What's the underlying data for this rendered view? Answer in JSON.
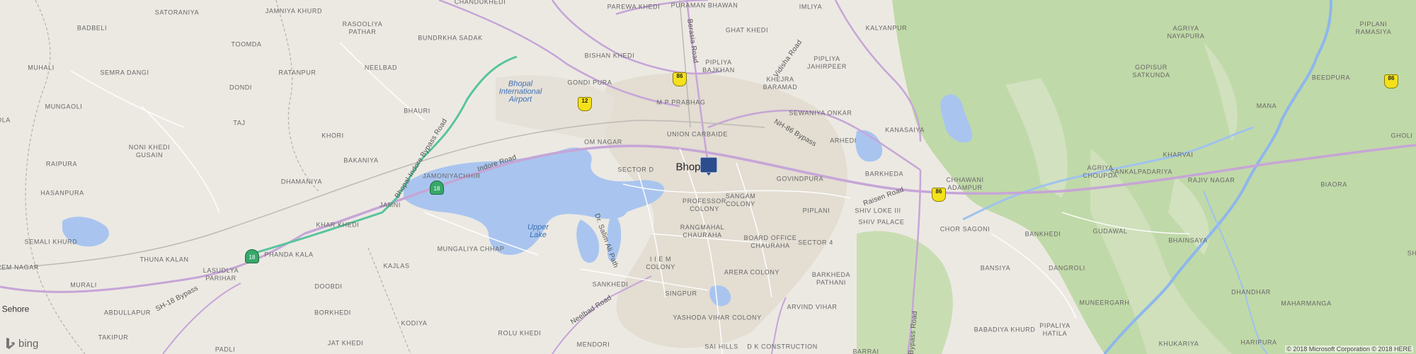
{
  "map": {
    "city_label": "Bhopal",
    "visible_city_label": "Bhop",
    "water": {
      "lake_upper": "Upper\nLake",
      "airport": "Bhopal\nInternational\nAirport"
    },
    "places": [
      {
        "id": "satoraniya",
        "text": "SATORANIYA"
      },
      {
        "id": "jamniya-khurd",
        "text": "JAMNIYA KHURD"
      },
      {
        "id": "chandukhedi",
        "text": "CHANDUKHEDI"
      },
      {
        "id": "parewa-khedi",
        "text": "PAREWA KHEDI"
      },
      {
        "id": "puraman-bhawan",
        "text": "PURAMAN BHAWAN"
      },
      {
        "id": "imliya",
        "text": "IMLIYA"
      },
      {
        "id": "badbeli",
        "text": "BADBELI"
      },
      {
        "id": "rasooliya-pathar",
        "text": "RASOOLIYA\nPATHAR"
      },
      {
        "id": "bundrkha-sadak",
        "text": "BUNDRKHA SADAK"
      },
      {
        "id": "ghat-khedi",
        "text": "GHAT KHEDI"
      },
      {
        "id": "kalyanpur",
        "text": "KALYANPUR"
      },
      {
        "id": "toomda",
        "text": "TOOMDA"
      },
      {
        "id": "bishan-khedi",
        "text": "BISHAN KHEDI"
      },
      {
        "id": "pipliya-bajkhan",
        "text": "PIPLIYA\nBAJKHAN"
      },
      {
        "id": "ratanpur",
        "text": "RATANPUR"
      },
      {
        "id": "neelbad",
        "text": "NEELBAD"
      },
      {
        "id": "pipliya-jahirpeer",
        "text": "PIPLIYA\nJAHIRPEER"
      },
      {
        "id": "muhali",
        "text": "MUHALI"
      },
      {
        "id": "semra-dangi",
        "text": "SEMRA DANGI"
      },
      {
        "id": "dondi",
        "text": "DONDI"
      },
      {
        "id": "gondi-pura",
        "text": "GONDI PURA"
      },
      {
        "id": "khejra-baramad",
        "text": "KHEJRA\nBARAMAD"
      },
      {
        "id": "m-p-prabhag",
        "text": "M P PRABHAG"
      },
      {
        "id": "sewaniya-onkar",
        "text": "SEWANIYA ONKAR"
      },
      {
        "id": "mungaoli",
        "text": "MUNGAOLI"
      },
      {
        "id": "bhauri",
        "text": "BHAURI"
      },
      {
        "id": "taj",
        "text": "TAJ"
      },
      {
        "id": "union-carbaide",
        "text": "UNION CARBAIDE"
      },
      {
        "id": "arhedi",
        "text": "ARHEDI"
      },
      {
        "id": "kanasaiya",
        "text": "KANASAIYA"
      },
      {
        "id": "khori",
        "text": "KHORI"
      },
      {
        "id": "om-nagar",
        "text": "OM NAGAR"
      },
      {
        "id": "noni-khedi-gusain",
        "text": "NONI KHEDI\nGUSAIN"
      },
      {
        "id": "raipura",
        "text": "RAIPURA"
      },
      {
        "id": "bakaniya",
        "text": "BAKANIYA"
      },
      {
        "id": "sector-d",
        "text": "SECTOR D"
      },
      {
        "id": "govindpura",
        "text": "GOVINDPURA"
      },
      {
        "id": "barkheda",
        "text": "BARKHEDA"
      },
      {
        "id": "chhawani-adampur",
        "text": "CHHAWANI\nADAMPUR"
      },
      {
        "id": "dhamaniya",
        "text": "DHAMANIYA"
      },
      {
        "id": "jamoniyachhir",
        "text": "JAMONIYACHHIR"
      },
      {
        "id": "hasanpura",
        "text": "HASANPURA"
      },
      {
        "id": "jamni",
        "text": "JAMNI"
      },
      {
        "id": "professor-colony",
        "text": "PROFESSOR\nCOLONY"
      },
      {
        "id": "sangam-colony",
        "text": "SANGAM\nCOLONY"
      },
      {
        "id": "piplani",
        "text": "PIPLANI"
      },
      {
        "id": "shiv-loke-iii",
        "text": "SHIV LOKE III"
      },
      {
        "id": "shiv-palace",
        "text": "SHIV PALACE"
      },
      {
        "id": "khar-khedi",
        "text": "KHAR KHEDI"
      },
      {
        "id": "semali-khurd",
        "text": "SEMALI KHURD"
      },
      {
        "id": "rangmahal-chauraha",
        "text": "RANGMAHAL\nCHAURAHA"
      },
      {
        "id": "board-office-chauraha",
        "text": "BOARD OFFICE\nCHAURAHA"
      },
      {
        "id": "sector-4",
        "text": "SECTOR 4"
      },
      {
        "id": "mungaliya-chhap",
        "text": "MUNGALIYA CHHAP"
      },
      {
        "id": "chor-sagoni",
        "text": "CHOR SAGONI"
      },
      {
        "id": "bankhedi",
        "text": "BANKHEDI"
      },
      {
        "id": "gudawal",
        "text": "GUDAWAL"
      },
      {
        "id": "phanda-kala",
        "text": "PHANDA KALA"
      },
      {
        "id": "thuna-kalan",
        "text": "THUNA KALAN"
      },
      {
        "id": "lasudlya-parihar",
        "text": "LASUDLYA\nPARIHAR"
      },
      {
        "id": "kajlas",
        "text": "KAJLAS"
      },
      {
        "id": "i-i-e-m-colony",
        "text": "I I E M\nCOLONY"
      },
      {
        "id": "arera-colony",
        "text": "ARERA COLONY"
      },
      {
        "id": "barkheda-pathani",
        "text": "BARKHEDA\nPATHANI"
      },
      {
        "id": "bansiya",
        "text": "BANSIYA"
      },
      {
        "id": "dangroli",
        "text": "DANGROLI"
      },
      {
        "id": "rem-nagar",
        "text": "REM NAGAR"
      },
      {
        "id": "murali",
        "text": "MURALI"
      },
      {
        "id": "doobdi",
        "text": "DOOBDI"
      },
      {
        "id": "sankhedi",
        "text": "SANKHEDI"
      },
      {
        "id": "singpur",
        "text": "SINGPUR"
      },
      {
        "id": "munergarh",
        "text": "MUNEERGARH"
      },
      {
        "id": "abdullapur",
        "text": "ABDULLAPUR"
      },
      {
        "id": "borkhedi",
        "text": "BORKHEDI"
      },
      {
        "id": "kodiya",
        "text": "KODIYA"
      },
      {
        "id": "yashoda-vihar-colony",
        "text": "YASHODA VIHAR COLONY"
      },
      {
        "id": "arvind-vihar",
        "text": "ARVIND VIHAR"
      },
      {
        "id": "babadiya-khurd",
        "text": "BABADIYA KHURD"
      },
      {
        "id": "pipaliya-hatila",
        "text": "PIPALIYA\nHATILA"
      },
      {
        "id": "takipur",
        "text": "TAKIPUR"
      },
      {
        "id": "rolu-khedi",
        "text": "ROLU KHEDI"
      },
      {
        "id": "padli",
        "text": "PADLI"
      },
      {
        "id": "jat-khedi",
        "text": "JAT KHEDI"
      },
      {
        "id": "mendori",
        "text": "MENDORI"
      },
      {
        "id": "sai-hills",
        "text": "SAI HILLS"
      },
      {
        "id": "d-k-construction",
        "text": "D K CONSTRUCTION"
      },
      {
        "id": "barrai",
        "text": "BARRAI"
      },
      {
        "id": "agriya-nayapura",
        "text": "AGRIYA\nNAYAPURA"
      },
      {
        "id": "piplani-ramasiya",
        "text": "PIPLANI\nRAMASIYA"
      },
      {
        "id": "gopisur-satkunda",
        "text": "GOPISUR\nSATKUNDA"
      },
      {
        "id": "beedpura",
        "text": "BEEDPURA"
      },
      {
        "id": "mana",
        "text": "MANA"
      },
      {
        "id": "kharvai",
        "text": "KHARVAI"
      },
      {
        "id": "agriya-choupda",
        "text": "AGRIYA\nCHOUPDA"
      },
      {
        "id": "sankalpadariya",
        "text": "SANKALPADARIYA"
      },
      {
        "id": "rajiv-nagar",
        "text": "RAJIV NAGAR"
      },
      {
        "id": "biaora",
        "text": "BIAORA"
      },
      {
        "id": "bhainsaya",
        "text": "BHAINSAYA"
      },
      {
        "id": "dhandhar",
        "text": "DHANDHAR"
      },
      {
        "id": "maharmanga",
        "text": "MAHARMANGA"
      },
      {
        "id": "khukariya",
        "text": "KHUKARIYA"
      },
      {
        "id": "haripura",
        "text": "HARIPURA"
      },
      {
        "id": "ola",
        "text": "OLA"
      },
      {
        "id": "gholi",
        "text": "GHOLI"
      },
      {
        "id": "shoi",
        "text": "SHOI"
      }
    ],
    "towns": [
      {
        "id": "sehore",
        "text": "Sehore"
      }
    ],
    "roads": [
      {
        "id": "berasia-road",
        "text": "Berasia Road"
      },
      {
        "id": "vidisha-road",
        "text": "Vidisha Road"
      },
      {
        "id": "nh86-bypass",
        "text": "NH-86 Bypass"
      },
      {
        "id": "bhopal-indore-bypass",
        "text": "Bhopal-Indore Bypass Road"
      },
      {
        "id": "indore-road",
        "text": "Indore Road"
      },
      {
        "id": "raisen-road",
        "text": "Raisen Road"
      },
      {
        "id": "sh18-bypass",
        "text": "SH-18 Bypass"
      },
      {
        "id": "neelbad-road",
        "text": "Neelbad Road"
      },
      {
        "id": "dr-salim-ali-path",
        "text": "Dr. Salim Ali Path"
      },
      {
        "id": "bypass-road",
        "text": "Bypass Road"
      }
    ],
    "shields": [
      {
        "id": "nh86-top",
        "text": "86",
        "kind": "state"
      },
      {
        "id": "sh12",
        "text": "12",
        "kind": "state"
      },
      {
        "id": "nh18-a",
        "text": "18",
        "kind": "nh"
      },
      {
        "id": "nh18-b",
        "text": "18",
        "kind": "nh"
      },
      {
        "id": "nh86-east",
        "text": "86",
        "kind": "state"
      },
      {
        "id": "nh86-far",
        "text": "86",
        "kind": "state"
      }
    ]
  },
  "branding": {
    "logo_text": "bing"
  },
  "attribution": "© 2018 Microsoft Corporation © 2018 HERE",
  "colors": {
    "land": "#ece9e3",
    "water": "#a9c5ef",
    "forest": "#b5d29a",
    "highway": "#c7a6d6",
    "nh": "#5ec7a1",
    "urban": "#e4dfd6"
  }
}
